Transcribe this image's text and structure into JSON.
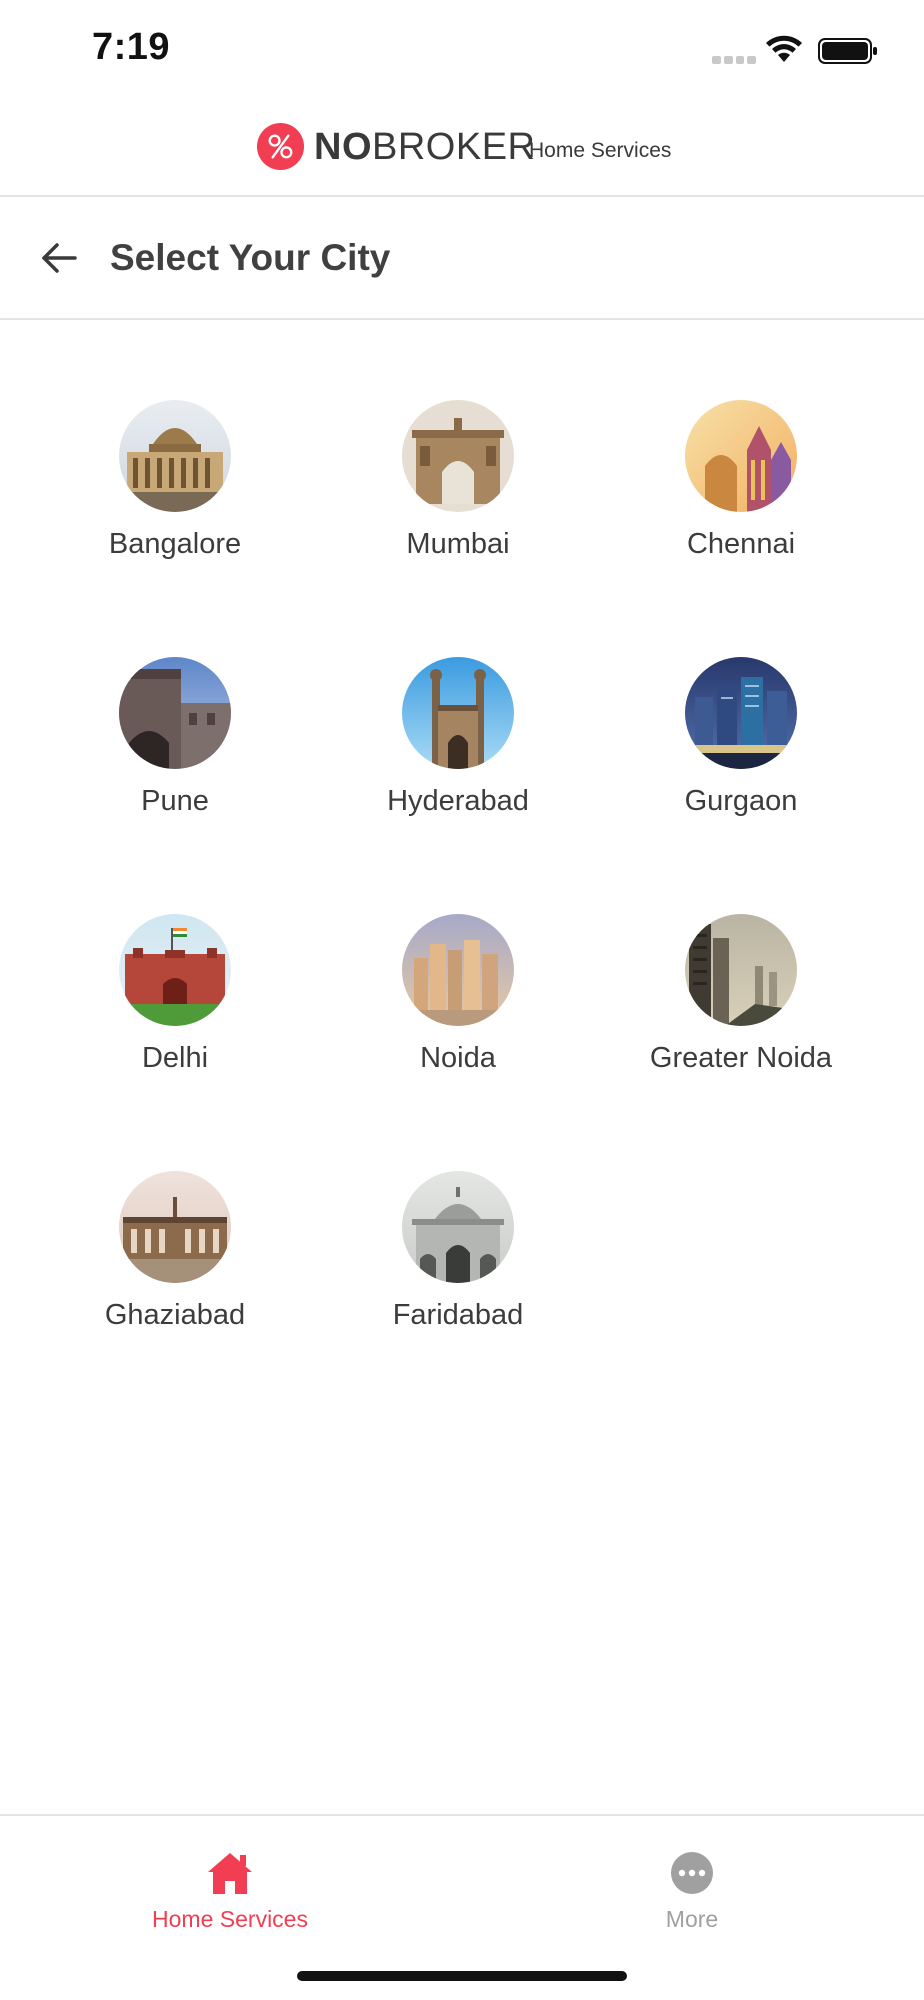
{
  "status_bar": {
    "time": "7:19"
  },
  "brand": {
    "name_bold": "NO",
    "name_rest": "BROKER",
    "subtitle": "Home Services",
    "accent": "#f13e52"
  },
  "header": {
    "title": "Select Your City",
    "back_icon": "arrow-left-icon"
  },
  "cities": [
    {
      "name": "Bangalore"
    },
    {
      "name": "Mumbai"
    },
    {
      "name": "Chennai"
    },
    {
      "name": "Pune"
    },
    {
      "name": "Hyderabad"
    },
    {
      "name": "Gurgaon"
    },
    {
      "name": "Delhi"
    },
    {
      "name": "Noida"
    },
    {
      "name": "Greater Noida"
    },
    {
      "name": "Ghaziabad"
    },
    {
      "name": "Faridabad"
    }
  ],
  "bottom_nav": [
    {
      "label": "Home Services",
      "icon": "house-icon",
      "active": true,
      "color": "#f13e52"
    },
    {
      "label": "More",
      "icon": "more-dots-icon",
      "active": false,
      "color": "#a0a0a0"
    }
  ]
}
